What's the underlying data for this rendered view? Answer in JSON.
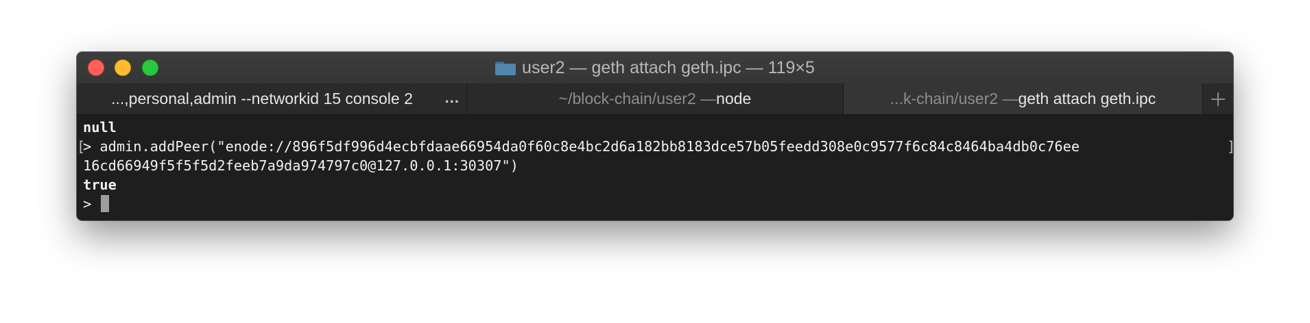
{
  "window": {
    "title": "user2 — geth attach geth.ipc — 119×5",
    "title_icon": "folder-icon"
  },
  "tabs": [
    {
      "label": "...,personal,admin --networkid 15 console 2",
      "more": "..."
    },
    {
      "label_dim": "~/block-chain/user2 — ",
      "label_bright": "node"
    },
    {
      "label_dim": "...k-chain/user2 — ",
      "label_bright": "geth attach geth.ipc",
      "active": true
    }
  ],
  "new_tab_icon": "plus-icon",
  "console": {
    "lines": [
      "null",
      "> admin.addPeer(\"enode://896f5df996d4ecbfdaae66954da0f60c8e4bc2d6a182bb8183dce57b05feedd308e0c9577f6c84c8464ba4db0c76ee",
      "16cd66949f5f5f5d2feeb7a9da974797c0@127.0.0.1:30307\")",
      "true",
      "> "
    ],
    "left_bracket": "[",
    "right_bracket": "]"
  }
}
